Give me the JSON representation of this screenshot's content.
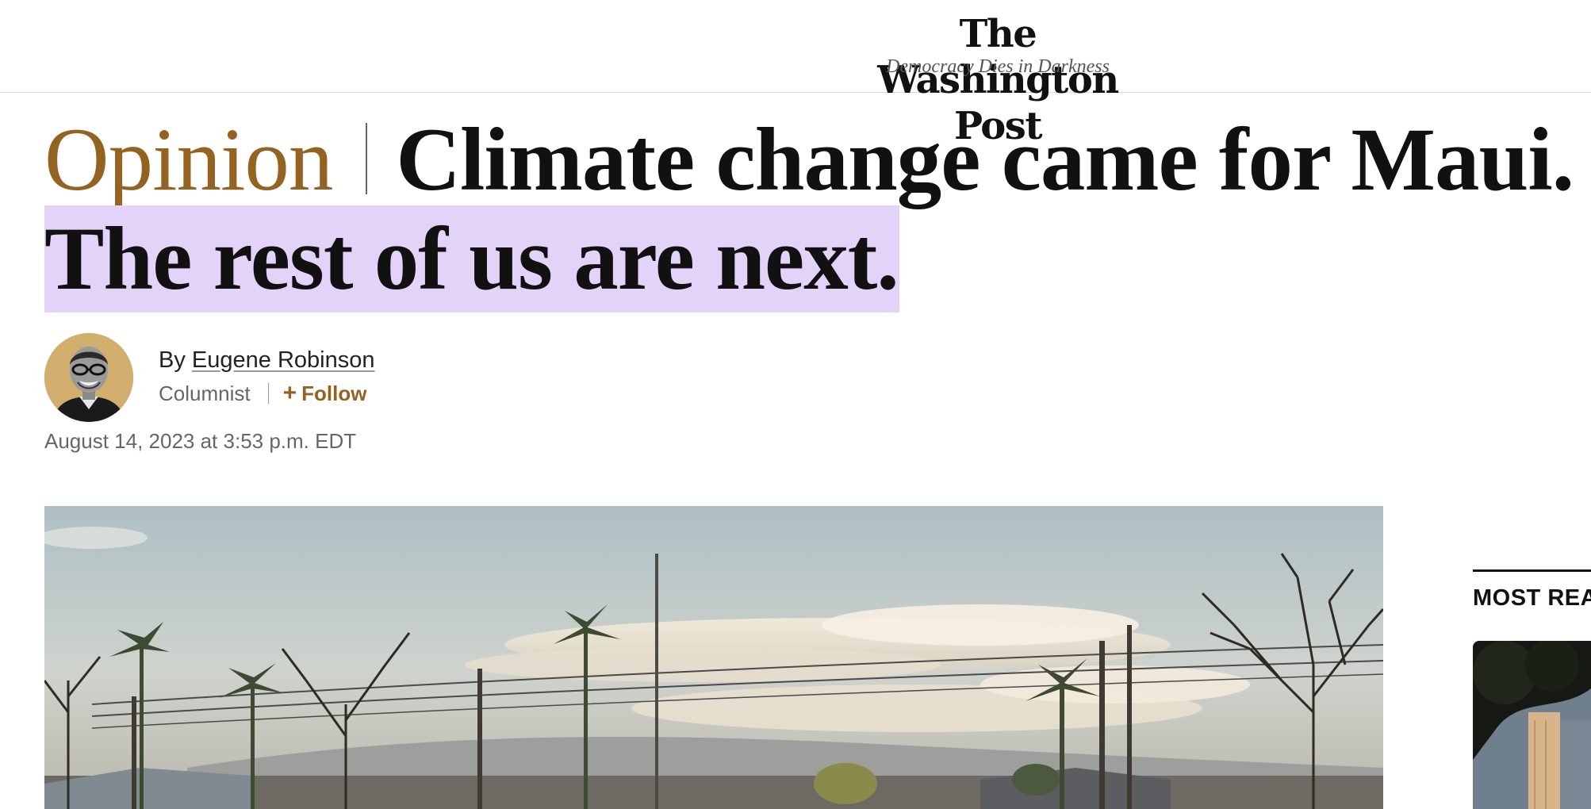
{
  "masthead": {
    "logo_text": "The Washington Post",
    "tagline": "Democracy Dies in Darkness"
  },
  "article": {
    "kicker": "Opinion",
    "headline_line1": "Climate change came for Maui.",
    "headline_line2": "The rest of us are next.",
    "byline_prefix": "By",
    "author": "Eugene Robinson",
    "role": "Columnist",
    "follow_label": "Follow",
    "follow_icon": "plus-icon",
    "date": "August 14, 2023 at 3:53 p.m. EDT"
  },
  "sidebar": {
    "title": "MOST READ"
  },
  "colors": {
    "kicker": "#946221",
    "highlight": "#e3d3f9",
    "avatar_bg": "#d1ad6e"
  }
}
